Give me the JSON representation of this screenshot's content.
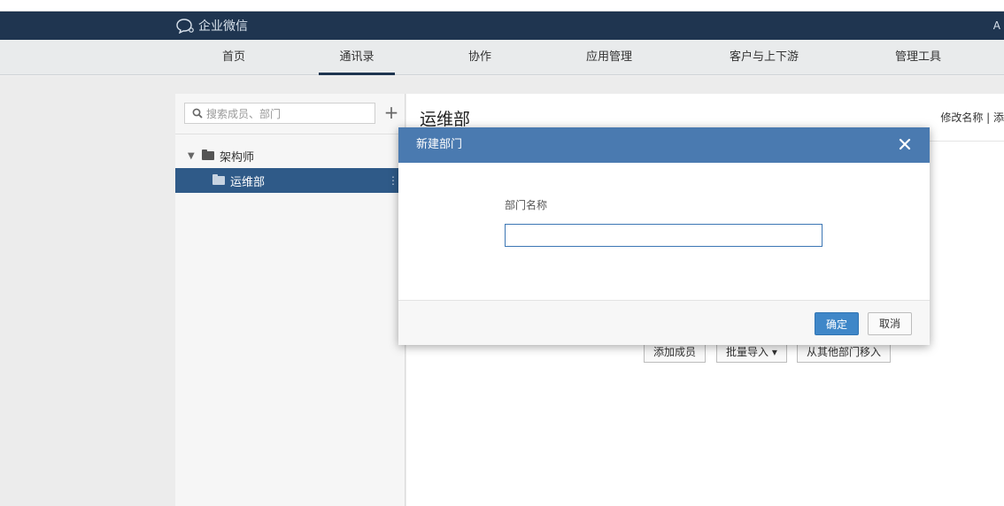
{
  "app": {
    "brand": "企业微信",
    "user_initial": "A"
  },
  "nav": {
    "tabs": [
      {
        "label": "首页",
        "active": false
      },
      {
        "label": "通讯录",
        "active": true
      },
      {
        "label": "协作",
        "active": false
      },
      {
        "label": "应用管理",
        "active": false
      },
      {
        "label": "客户与上下游",
        "active": false
      },
      {
        "label": "管理工具",
        "active": false
      }
    ]
  },
  "sidebar": {
    "search_placeholder": "搜索成员、部门",
    "add_icon": "plus-icon",
    "tree": [
      {
        "label": "架构师",
        "expanded": true,
        "selected": false
      },
      {
        "label": "运维部",
        "selected": true
      }
    ]
  },
  "main": {
    "dept_title": "运维部",
    "edit_links": "修改名称 | 添",
    "actions": {
      "add_member": "添加成员",
      "batch_import": "批量导入 ▾",
      "move_from_other": "从其他部门移入"
    }
  },
  "modal": {
    "title": "新建部门",
    "field_label": "部门名称",
    "field_value": "",
    "confirm_label": "确定",
    "cancel_label": "取消"
  },
  "colors": {
    "topbar": "#1f3550",
    "modal_header": "#4a7ab0",
    "primary_button": "#3f87c8",
    "tree_selected": "#2f5a88"
  }
}
